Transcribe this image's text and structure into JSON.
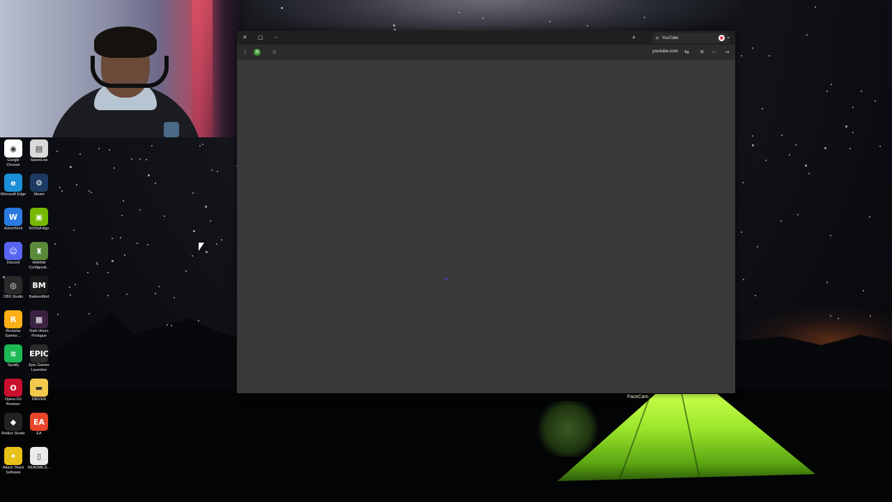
{
  "desktop": {
    "icons": [
      {
        "label": "Google Chrome",
        "icon": "chrome-icon",
        "color": "#ffffff"
      },
      {
        "label": "SweetLow",
        "icon": "sweetlow-icon",
        "color": "#d9d9d9"
      },
      {
        "label": "Microsoft Edge",
        "icon": "edge-icon",
        "color": "#1b8fd8"
      },
      {
        "label": "Steam",
        "icon": "steam-icon",
        "color": "#1d3a63"
      },
      {
        "label": "AnkerWork",
        "icon": "ankerwork-icon",
        "color": "#2a7be0"
      },
      {
        "label": "NVIDIA App",
        "icon": "nvidia-icon",
        "color": "#76b900"
      },
      {
        "label": "Discord",
        "icon": "discord-icon",
        "color": "#5865f2"
      },
      {
        "label": "HidHide Configurat...",
        "icon": "hidhide-icon",
        "color": "#5a8a3a"
      },
      {
        "label": "OBS Studio",
        "icon": "obs-icon",
        "color": "#2a2a2a"
      },
      {
        "label": "BakkesMod",
        "icon": "bakkesmod-icon",
        "color": "#1a1a1a"
      },
      {
        "label": "Rockstar Games ...",
        "icon": "rockstar-icon",
        "color": "#fcaf17"
      },
      {
        "label": "Dark Hours Prologue",
        "icon": "darkhours-icon",
        "color": "#3a2240"
      },
      {
        "label": "Spotify",
        "icon": "spotify-icon",
        "color": "#1db954"
      },
      {
        "label": "Epic Games Launcher",
        "icon": "epic-icon",
        "color": "#2a2a2a"
      },
      {
        "label": "Opera GX Browser",
        "icon": "operagx-icon",
        "color": "#c8102e"
      },
      {
        "label": "DRIVER",
        "icon": "folder-icon",
        "color": "#f2c94c"
      },
      {
        "label": "Roblox Studio",
        "icon": "roblox-icon",
        "color": "#222222"
      },
      {
        "label": "EA",
        "icon": "ea-icon",
        "color": "#e8452a"
      },
      {
        "label": "Attack Shark Software",
        "icon": "attackshark-icon",
        "color": "#e8c21a"
      },
      {
        "label": "README.E...",
        "icon": "file-icon",
        "color": "#eaeaea"
      }
    ],
    "glyphs": [
      "◉",
      "▤",
      "e",
      "⚙",
      "W",
      "▣",
      "☺",
      "♜",
      "◎",
      "BM",
      "R",
      "▦",
      "≋",
      "EPIC",
      "O",
      "▬",
      "◆",
      "EA",
      "✦",
      "▯"
    ],
    "tent_label": "FaceCam"
  },
  "browser": {
    "tab_title": "YouTube",
    "url": "youtube.com",
    "profile_initial": "M",
    "window_controls": {
      "close": "✕",
      "maximize": "▢",
      "minimize": "–"
    },
    "new_tab": "+",
    "nav": {
      "back": "←",
      "forward": "→",
      "stop": "✕"
    },
    "bookmark_star": "☆",
    "site_settings": "⇆",
    "menu_dots": "⋮",
    "tab_list": "⌄"
  }
}
